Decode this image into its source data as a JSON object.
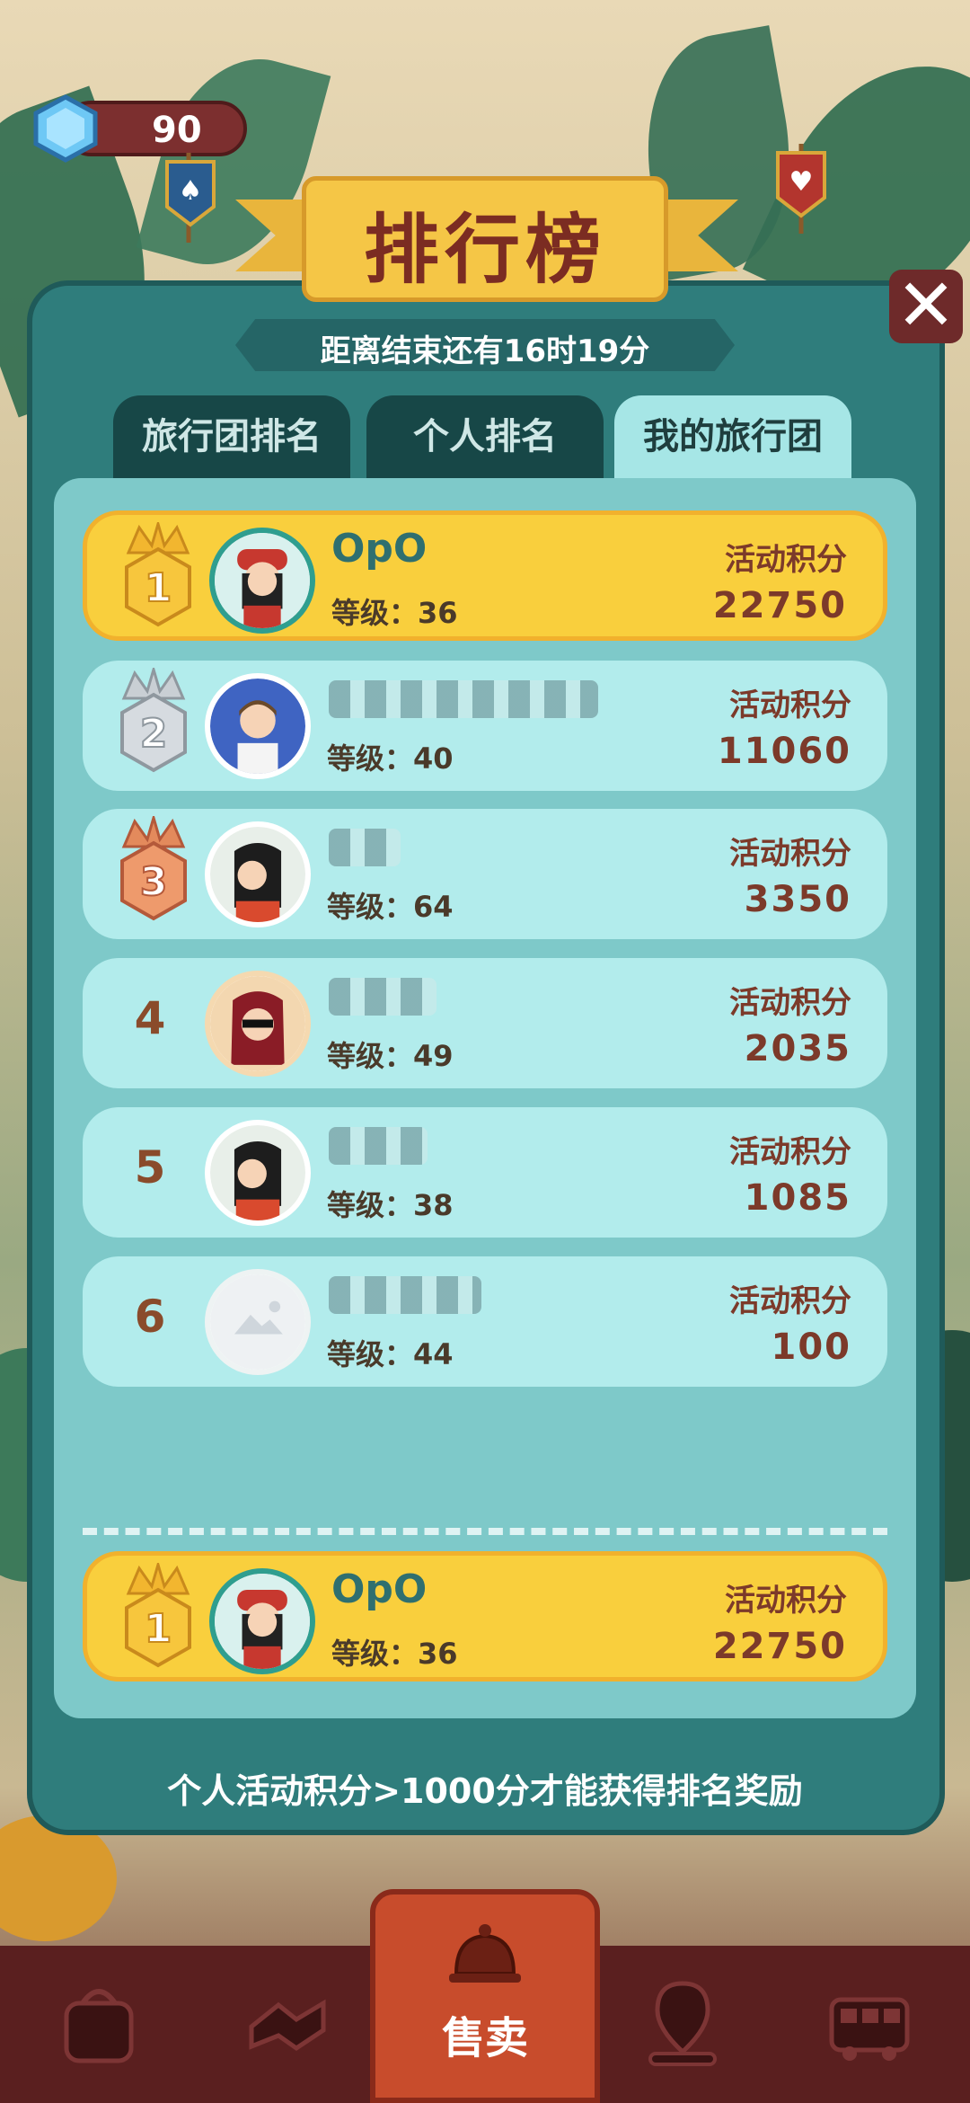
{
  "top": {
    "gems": "90"
  },
  "title": "排行榜",
  "timer": "距离结束还有16时19分",
  "tabs": [
    {
      "label": "旅行团排名",
      "active": false
    },
    {
      "label": "个人排名",
      "active": false
    },
    {
      "label": "我的旅行团",
      "active": true
    }
  ],
  "rows": [
    {
      "rank": "1",
      "name": "OpO",
      "level_label": "等级：",
      "level": "36",
      "points_label": "活动积分",
      "points": "22750",
      "highlight": true
    },
    {
      "rank": "2",
      "name": "",
      "level_label": "等级：",
      "level": "40",
      "points_label": "活动积分",
      "points": "11060",
      "highlight": false
    },
    {
      "rank": "3",
      "name": "",
      "level_label": "等级：",
      "level": "64",
      "points_label": "活动积分",
      "points": "3350",
      "highlight": false
    },
    {
      "rank": "4",
      "name": "",
      "level_label": "等级：",
      "level": "49",
      "points_label": "活动积分",
      "points": "2035",
      "highlight": false
    },
    {
      "rank": "5",
      "name": "",
      "level_label": "等级：",
      "level": "38",
      "points_label": "活动积分",
      "points": "1085",
      "highlight": false
    },
    {
      "rank": "6",
      "name": "",
      "level_label": "等级：",
      "level": "44",
      "points_label": "活动积分",
      "points": "100",
      "highlight": false
    }
  ],
  "my_row": {
    "rank": "1",
    "name": "OpO",
    "level_label": "等级：",
    "level": "36",
    "points_label": "活动积分",
    "points": "22750"
  },
  "footer_note": "个人活动积分>1000分才能获得排名奖励",
  "nav": {
    "center_label": "售卖"
  },
  "colors": {
    "gold": "#f9cf3d",
    "panel": "#2f7d7c",
    "row": "#b2ecec"
  }
}
